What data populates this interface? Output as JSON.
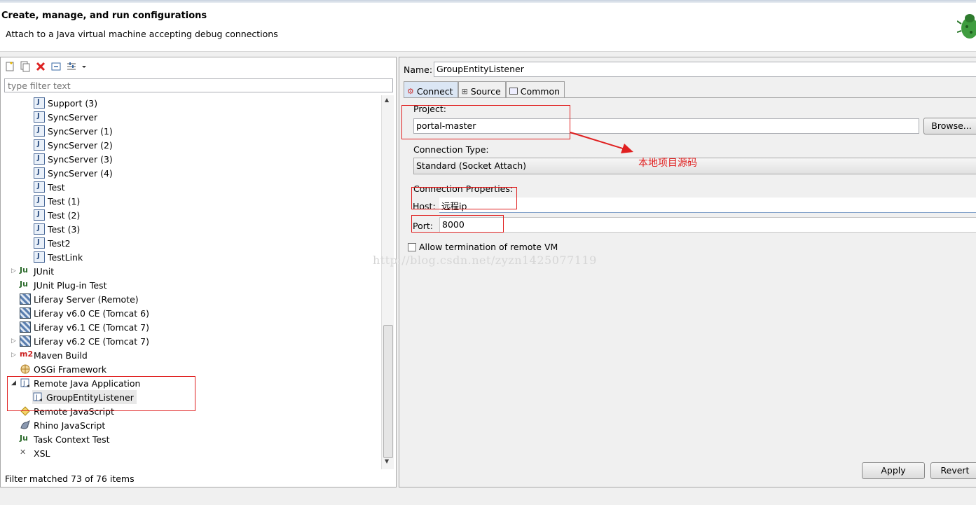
{
  "header": {
    "title": "Create, manage, and run configurations",
    "subtitle": "Attach to a Java virtual machine accepting debug connections"
  },
  "left": {
    "filter_placeholder": "type filter text",
    "tree": [
      {
        "label": "Support (3)",
        "icon": "java-launch-icon"
      },
      {
        "label": "SyncServer",
        "icon": "java-launch-icon"
      },
      {
        "label": "SyncServer (1)",
        "icon": "java-launch-icon"
      },
      {
        "label": "SyncServer (2)",
        "icon": "java-launch-icon"
      },
      {
        "label": "SyncServer (3)",
        "icon": "java-launch-icon"
      },
      {
        "label": "SyncServer (4)",
        "icon": "java-launch-icon"
      },
      {
        "label": "Test",
        "icon": "java-launch-icon"
      },
      {
        "label": "Test (1)",
        "icon": "java-launch-icon"
      },
      {
        "label": "Test (2)",
        "icon": "java-launch-icon"
      },
      {
        "label": "Test (3)",
        "icon": "java-launch-icon"
      },
      {
        "label": "Test2",
        "icon": "java-launch-icon"
      },
      {
        "label": "TestLink",
        "icon": "java-launch-icon"
      },
      {
        "label": "JUnit",
        "icon": "junit-icon"
      },
      {
        "label": "JUnit Plug-in Test",
        "icon": "junit-plugin-icon"
      },
      {
        "label": "Liferay Server (Remote)",
        "icon": "liferay-icon"
      },
      {
        "label": "Liferay v6.0 CE (Tomcat 6)",
        "icon": "liferay-icon"
      },
      {
        "label": "Liferay v6.1 CE (Tomcat 7)",
        "icon": "liferay-icon"
      },
      {
        "label": "Liferay v6.2 CE (Tomcat 7)",
        "icon": "liferay-icon"
      },
      {
        "label": "Maven Build",
        "icon": "maven-icon"
      },
      {
        "label": "OSGi Framework",
        "icon": "osgi-icon"
      },
      {
        "label": "Remote Java Application",
        "icon": "remote-java-icon"
      },
      {
        "label": "GroupEntityListener",
        "icon": "remote-java-icon"
      },
      {
        "label": "Remote JavaScript",
        "icon": "remote-js-icon"
      },
      {
        "label": "Rhino JavaScript",
        "icon": "rhino-icon"
      },
      {
        "label": "Task Context Test",
        "icon": "task-context-icon"
      },
      {
        "label": "XSL",
        "icon": "xsl-icon"
      }
    ],
    "status": "Filter matched 73 of 76 items"
  },
  "right": {
    "name_label": "Name:",
    "name_value": "GroupEntityListener",
    "tabs": [
      "Connect",
      "Source",
      "Common"
    ],
    "project_label": "Project:",
    "project_value": "portal-master",
    "browse_label": "Browse...",
    "connection_type_label": "Connection Type:",
    "connection_type_value": "Standard (Socket Attach)",
    "connection_props_label": "Connection Properties:",
    "host_label": "Host:",
    "host_value": "远程ip",
    "port_label": "Port:",
    "port_value": "8000",
    "allow_termination_label": "Allow termination of remote VM",
    "apply_label": "Apply",
    "revert_label": "Revert"
  },
  "annotation": "本地项目源码",
  "watermark": "http://blog.csdn.net/zyzn1425077119",
  "colors": {
    "annotation_red": "#e02020",
    "selected_tab": "#dbe6f4"
  }
}
